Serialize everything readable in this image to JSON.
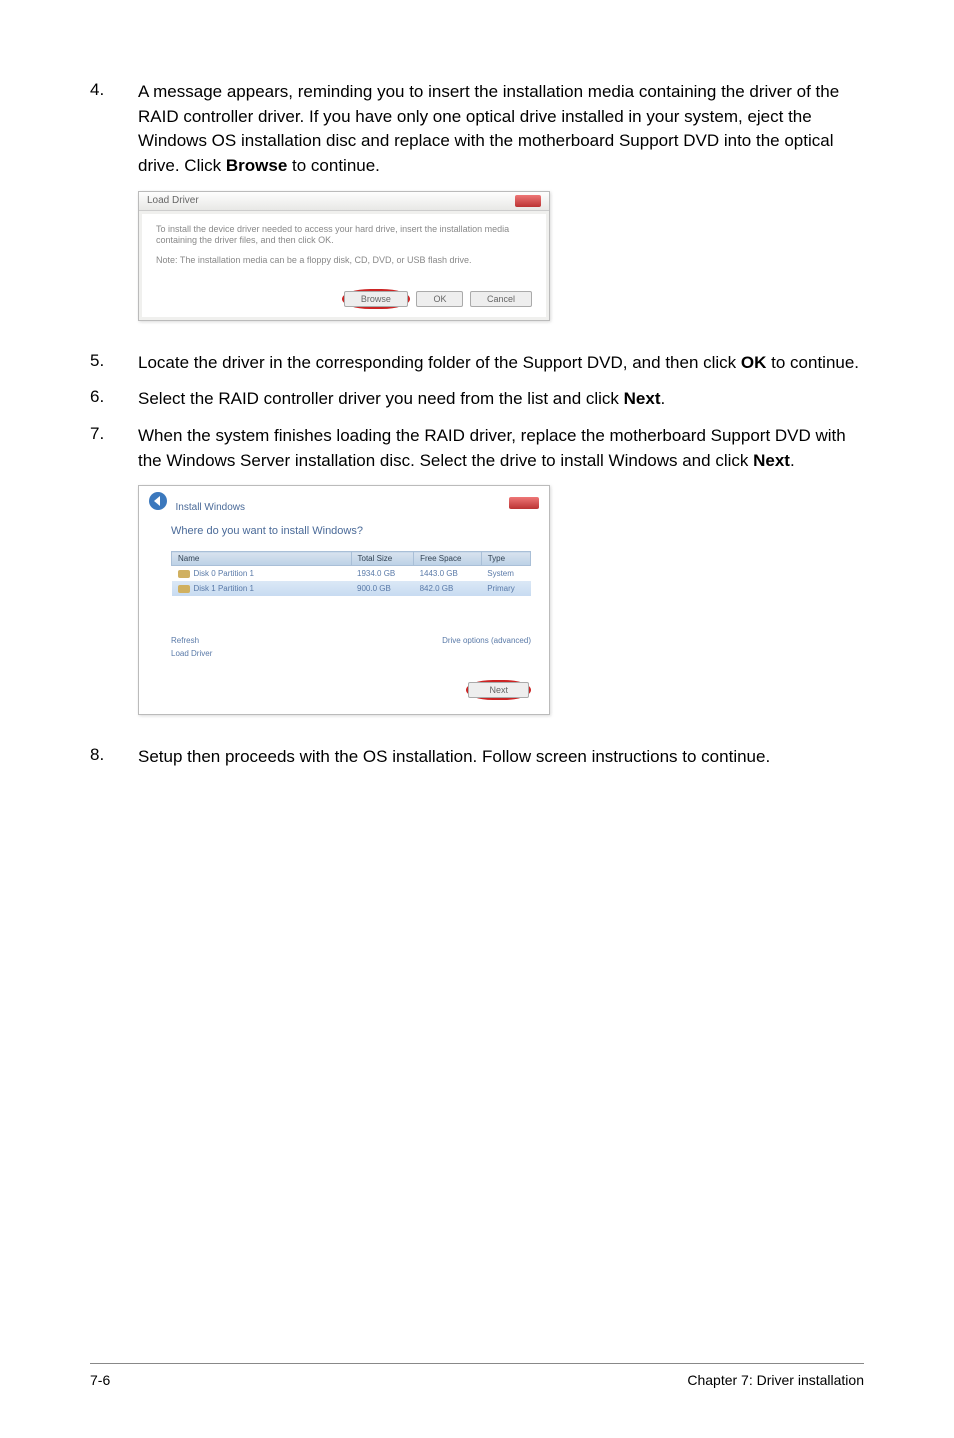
{
  "steps": {
    "s4": {
      "num": "4.",
      "text_a": "A message appears, reminding you to insert the installation media containing the driver of the RAID controller driver. If you have only one optical drive installed in your system, eject the Windows OS installation disc and replace with the motherboard Support DVD into the optical drive. Click ",
      "bold1": "Browse",
      "text_b": " to continue."
    },
    "s5": {
      "num": "5.",
      "text_a": "Locate the driver in the corresponding folder of the Support DVD, and then click ",
      "bold1": "OK",
      "text_b": " to continue."
    },
    "s6": {
      "num": "6.",
      "text_a": "Select the RAID controller driver you need from the list and click ",
      "bold1": "Next",
      "text_b": "."
    },
    "s7": {
      "num": "7.",
      "text_a": "When the system finishes loading the RAID driver, replace the motherboard Support DVD with the Windows Server installation disc. Select the drive to install Windows and click ",
      "bold1": "Next",
      "text_b": "."
    },
    "s8": {
      "num": "8.",
      "text_a": "Setup then proceeds with the OS installation. Follow screen instructions to continue."
    }
  },
  "dialog1": {
    "title": "Load Driver",
    "line1": "To install the device driver needed to access your hard drive, insert the installation media containing the driver files, and then click OK.",
    "line2": "Note: The installation media can be a floppy disk, CD, DVD, or USB flash drive.",
    "browse": "Browse",
    "ok": "OK",
    "cancel": "Cancel"
  },
  "dialog2": {
    "title": "Install Windows",
    "heading": "Where do you want to install Windows?",
    "cols": {
      "name": "Name",
      "total": "Total Size",
      "free": "Free Space",
      "type": "Type"
    },
    "rows": [
      {
        "name": "Disk 0 Partition 1",
        "total": "1934.0 GB",
        "free": "1443.0 GB",
        "type": "System"
      },
      {
        "name": "Disk 1 Partition 1",
        "total": "900.0 GB",
        "free": "842.0 GB",
        "type": "Primary"
      }
    ],
    "refresh": "Refresh",
    "load": "Load Driver",
    "advanced": "Drive options (advanced)",
    "next": "Next"
  },
  "footer": {
    "left": "7-6",
    "right": "Chapter 7: Driver installation"
  }
}
